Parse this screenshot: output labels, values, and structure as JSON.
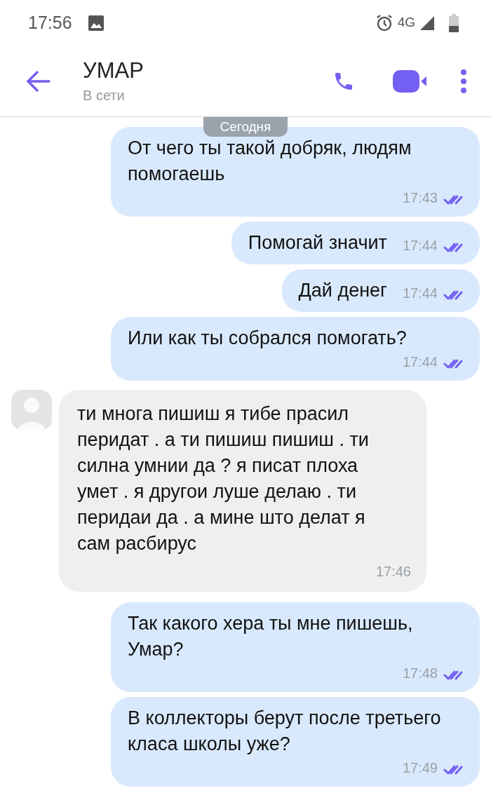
{
  "status_bar": {
    "time": "17:56",
    "network": "4G"
  },
  "header": {
    "name": "УМАР",
    "status": "В сети"
  },
  "date_badge": "Сегодня",
  "messages": [
    {
      "kind": "outgoing",
      "text": "От чего ты такой добряк, людям помогаешь",
      "time": "17:43",
      "read": true
    },
    {
      "kind": "outgoing",
      "text": "Помогай значит",
      "time": "17:44",
      "read": true
    },
    {
      "kind": "outgoing",
      "text": "Дай денег",
      "time": "17:44",
      "read": true
    },
    {
      "kind": "outgoing",
      "text": "Или как ты собрался помогать?",
      "time": "17:44",
      "read": true
    },
    {
      "kind": "incoming",
      "text": "ти многа пишиш я тибе прасил перидат . а ти пишиш пишиш . ти силна умнии да ? я писат плоха умет . я другои луше делаю . ти перидаи да . а мине што делат я сам расбирус",
      "time": "17:46"
    },
    {
      "kind": "outgoing",
      "text": "Так какого хера ты мне пишешь, Умар?",
      "time": "17:48",
      "read": true
    },
    {
      "kind": "outgoing",
      "text": "В коллекторы берут после третьего класа школы уже?",
      "time": "17:49",
      "read": true
    }
  ]
}
